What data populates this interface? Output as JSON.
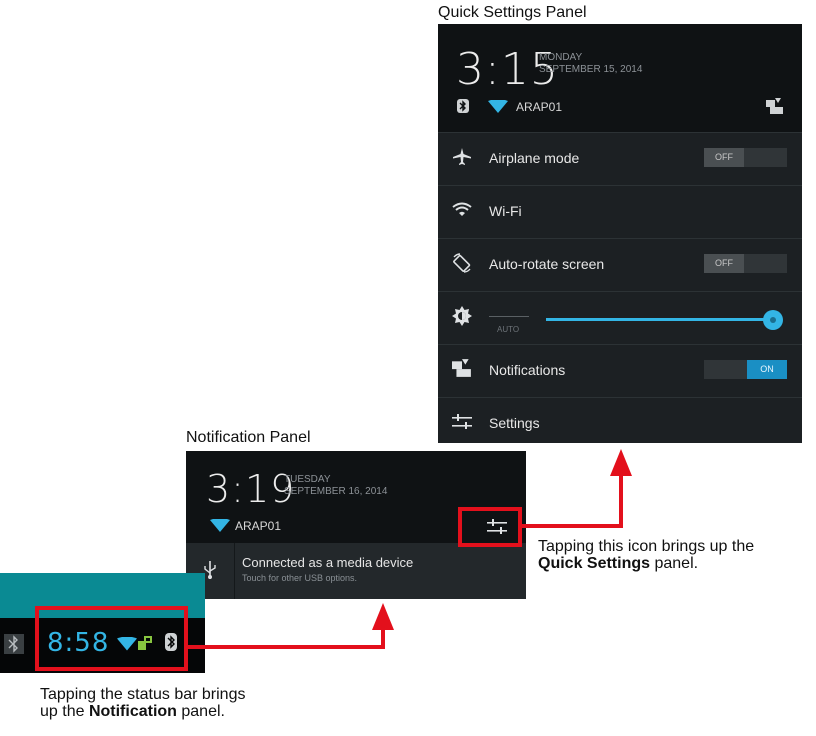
{
  "captions": {
    "quick_settings_title": "Quick Settings Panel",
    "notification_title": "Notification Panel",
    "status_bar_text_1": "Tapping the status bar brings",
    "status_bar_text_2": "up the ",
    "status_bar_bold": "Notification",
    "status_bar_text_3": " panel.",
    "icon_text_1": "Tapping this icon brings up the",
    "icon_bold": "Quick Settings",
    "icon_text_2": " panel."
  },
  "quick_settings": {
    "time": "3:15",
    "day": "MONDAY",
    "date": "SEPTEMBER 15, 2014",
    "network": "ARAP01",
    "rows": [
      {
        "label": "Airplane mode",
        "toggle": "OFF"
      },
      {
        "label": "Wi-Fi"
      },
      {
        "label": "Auto-rotate screen",
        "toggle": "OFF"
      },
      {
        "label": "AUTO",
        "brightness_level": 1.0
      },
      {
        "label": "Notifications",
        "toggle": "ON"
      },
      {
        "label": "Settings"
      }
    ]
  },
  "notification_panel": {
    "time": "3:19",
    "day": "TUESDAY",
    "date": "SEPTEMBER 16, 2014",
    "network": "ARAP01",
    "usb_title": "Connected as a media device",
    "usb_subtitle": "Touch for other USB options."
  },
  "status_bar": {
    "time": "8:58"
  },
  "colors": {
    "highlight_red": "#e3101c",
    "holo_blue": "#33b5e5",
    "teal": "#0a8a93"
  }
}
